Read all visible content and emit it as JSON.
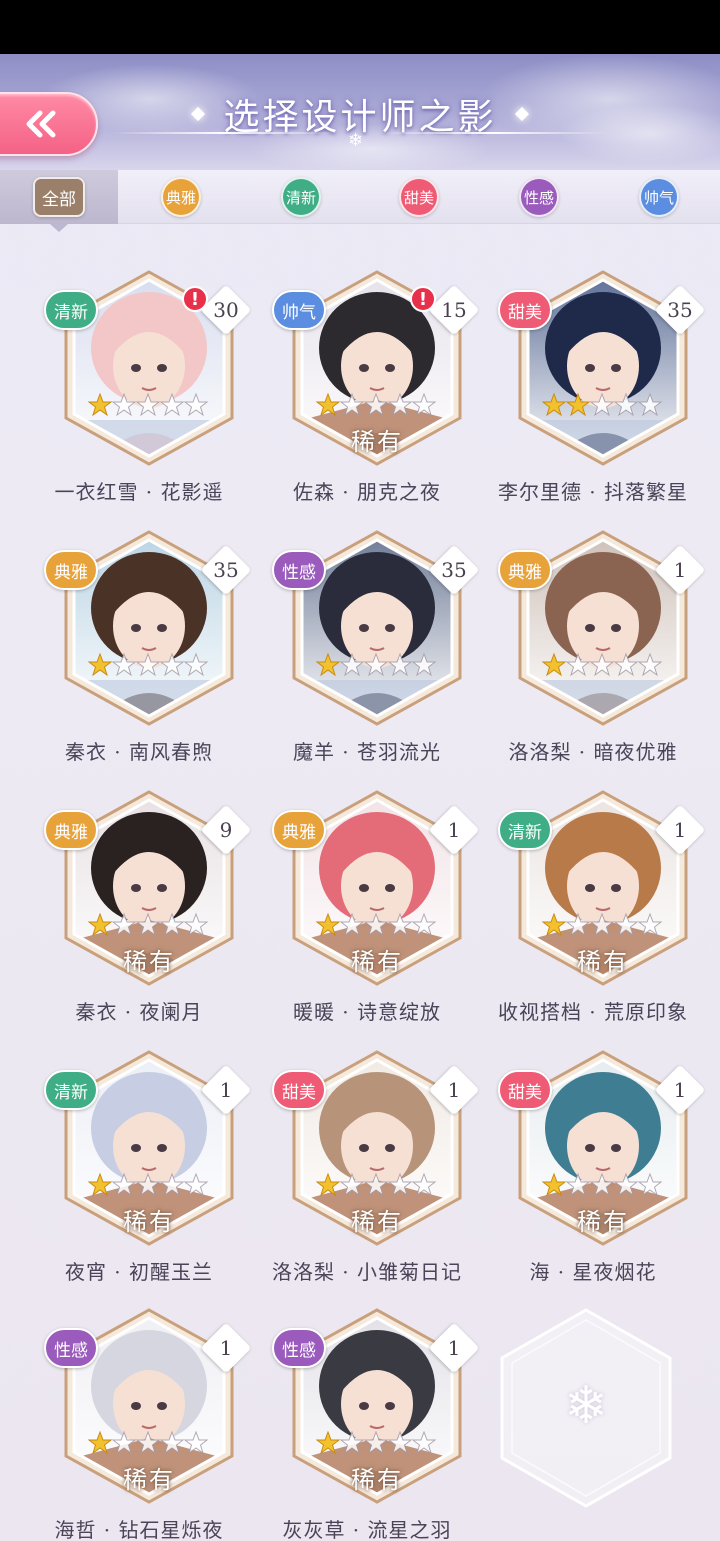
{
  "header": {
    "title": "选择设计师之影"
  },
  "tabs": [
    {
      "label": "全部",
      "color": "#9a7f6b",
      "active": true
    },
    {
      "label": "典雅",
      "color": "#e8a23a",
      "active": false
    },
    {
      "label": "清新",
      "color": "#3fae86",
      "active": false
    },
    {
      "label": "甜美",
      "color": "#ef5a74",
      "active": false
    },
    {
      "label": "性感",
      "color": "#9a5bbd",
      "active": false
    },
    {
      "label": "帅气",
      "color": "#5b8de0",
      "active": false
    }
  ],
  "category_colors": {
    "清新": "#3fae86",
    "帅气": "#5b8de0",
    "甜美": "#ef5a74",
    "典雅": "#e8a23a",
    "性感": "#9a5bbd"
  },
  "cards": [
    {
      "name": "一衣红雪 · 花影遥",
      "category": "清新",
      "count": "30",
      "alert": true,
      "stars": 1,
      "rarity": "",
      "hair": "#f3c6c8",
      "bg": "#d7dcee"
    },
    {
      "name": "佐森 · 朋克之夜",
      "category": "帅气",
      "count": "15",
      "alert": true,
      "stars": 1,
      "rarity": "稀有",
      "hair": "#2c2a2e",
      "bg": "#e6e1ea"
    },
    {
      "name": "李尔里德 · 抖落繁星",
      "category": "甜美",
      "count": "35",
      "alert": false,
      "stars": 2,
      "rarity": "",
      "hair": "#1f2a4a",
      "bg": "#5a6c95"
    },
    {
      "name": "秦衣 · 南风春煦",
      "category": "典雅",
      "count": "35",
      "alert": false,
      "stars": 1,
      "rarity": "",
      "hair": "#4a3326",
      "bg": "#b9d3e3"
    },
    {
      "name": "魔羊 · 苍羽流光",
      "category": "性感",
      "count": "35",
      "alert": false,
      "stars": 1,
      "rarity": "",
      "hair": "#2a2c3c",
      "bg": "#6b7894"
    },
    {
      "name": "洛洛梨 · 暗夜优雅",
      "category": "典雅",
      "count": "1",
      "alert": false,
      "stars": 1,
      "rarity": "",
      "hair": "#8a6450",
      "bg": "#cdbfb7"
    },
    {
      "name": "秦衣 · 夜阑月",
      "category": "典雅",
      "count": "9",
      "alert": false,
      "stars": 1,
      "rarity": "稀有",
      "hair": "#2a2220",
      "bg": "#e7e0e3"
    },
    {
      "name": "暖暖 · 诗意绽放",
      "category": "典雅",
      "count": "1",
      "alert": false,
      "stars": 1,
      "rarity": "稀有",
      "hair": "#e36c78",
      "bg": "#f1e2e6"
    },
    {
      "name": "收视搭档 · 荒原印象",
      "category": "清新",
      "count": "1",
      "alert": false,
      "stars": 1,
      "rarity": "稀有",
      "hair": "#b97a4a",
      "bg": "#eae3e0"
    },
    {
      "name": "夜宵 · 初醒玉兰",
      "category": "清新",
      "count": "1",
      "alert": false,
      "stars": 1,
      "rarity": "稀有",
      "hair": "#c7cde2",
      "bg": "#eceef6"
    },
    {
      "name": "洛洛梨 · 小雏菊日记",
      "category": "甜美",
      "count": "1",
      "alert": false,
      "stars": 1,
      "rarity": "稀有",
      "hair": "#b79479",
      "bg": "#f0e9e3"
    },
    {
      "name": "海 · 星夜烟花",
      "category": "甜美",
      "count": "1",
      "alert": false,
      "stars": 1,
      "rarity": "稀有",
      "hair": "#3f7e92",
      "bg": "#e6ecef"
    },
    {
      "name": "海哲 · 钻石星烁夜",
      "category": "性感",
      "count": "1",
      "alert": false,
      "stars": 1,
      "rarity": "稀有",
      "hair": "#d5d6df",
      "bg": "#efeff4"
    },
    {
      "name": "灰灰草 · 流星之羽",
      "category": "性感",
      "count": "1",
      "alert": false,
      "stars": 1,
      "rarity": "稀有",
      "hair": "#3a3a42",
      "bg": "#e2e0e6"
    }
  ]
}
